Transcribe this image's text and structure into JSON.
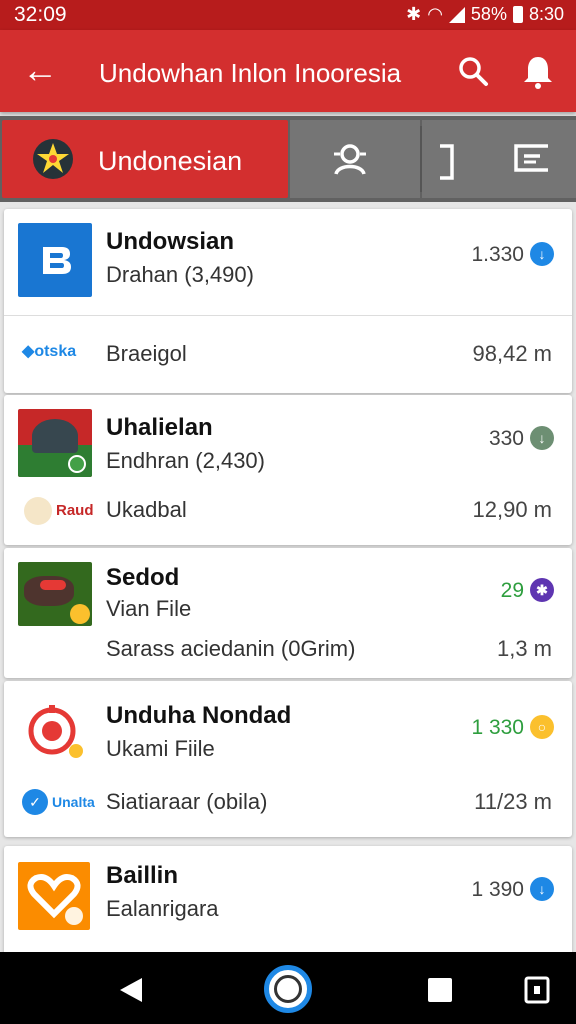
{
  "status": {
    "time": "32:09",
    "battery": "58%",
    "clock": "8:30"
  },
  "appbar": {
    "title": "Undowhan Inlon Inooresia"
  },
  "tabs": {
    "active_label": "Undonesian"
  },
  "items": [
    {
      "title": "Undowsian",
      "subtitle": "Drahan (3,490)",
      "count": "1.330",
      "dot_color": "#1e88e5",
      "sub_logo": "otska",
      "sub_label": "Braeigol",
      "sub_value": "98,42 m"
    },
    {
      "title": "Uhalielan",
      "subtitle": "Endhran (2,430)",
      "count": "330",
      "dot_color": "#6d8f73",
      "sub_logo": "Raud",
      "sub_label": "Ukadbal",
      "sub_value": "12,90 m"
    },
    {
      "title": "Sedod",
      "subtitle": "Vian File",
      "count": "29",
      "count_color": "#2e9e3e",
      "dot_color": "#5e35b1",
      "sub_label": "Sarass aciedanin (0Grim)",
      "sub_value": "1,3 m"
    },
    {
      "title": "Unduha Nondad",
      "subtitle": "Ukami Fiile",
      "count": "1 330",
      "count_color": "#2e9e3e",
      "dot_color": "#fbc02d",
      "sub_logo": "Unalta",
      "sub_label": "Siatiaraar (obila)",
      "sub_value": "11/23 m"
    },
    {
      "title": "Baillin",
      "subtitle": "Ealanrigara",
      "count": "1 390",
      "dot_color": "#1e88e5"
    }
  ]
}
